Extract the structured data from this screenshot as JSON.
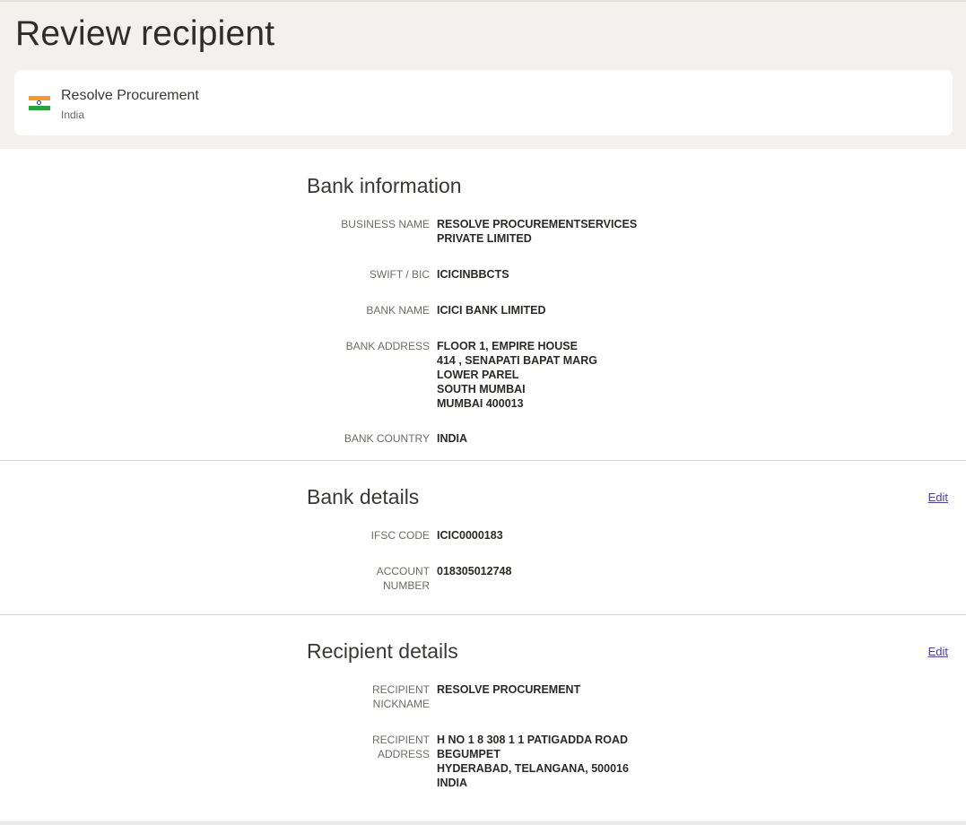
{
  "page": {
    "title": "Review recipient"
  },
  "recipient_card": {
    "flag_icon": "india-flag-icon",
    "name": "Resolve Procurement",
    "country": "India"
  },
  "bank_information": {
    "heading": "Bank information",
    "rows": [
      {
        "label": "BUSINESS NAME",
        "value": "RESOLVE PROCUREMENTSERVICES\nPRIVATE LIMITED"
      },
      {
        "label": "SWIFT / BIC",
        "value": "ICICINBBCTS"
      },
      {
        "label": "BANK NAME",
        "value": "ICICI BANK LIMITED"
      },
      {
        "label": "BANK ADDRESS",
        "value": "FLOOR 1, EMPIRE HOUSE\n414 , SENAPATI BAPAT MARG\nLOWER PAREL\nSOUTH MUMBAI\nMUMBAI 400013"
      },
      {
        "label": "BANK COUNTRY",
        "value": "INDIA"
      }
    ]
  },
  "bank_details": {
    "heading": "Bank details",
    "edit_label": "Edit",
    "rows": [
      {
        "label": "IFSC CODE",
        "value": "ICIC0000183"
      },
      {
        "label": "ACCOUNT\nNUMBER",
        "value": "018305012748"
      }
    ]
  },
  "recipient_details": {
    "heading": "Recipient details",
    "edit_label": "Edit",
    "rows": [
      {
        "label": "RECIPIENT\nNICKNAME",
        "value": "RESOLVE PROCUREMENT"
      },
      {
        "label": "RECIPIENT\nADDRESS",
        "value": "H NO 1 8 308 1 1 PATIGADDA ROAD\nBEGUMPET\nHYDERABAD, TELANGANA, 500016\nINDIA"
      }
    ]
  },
  "colors": {
    "header_background": "#f3f0ed",
    "link": "#4a3f9a",
    "divider": "#d8d5d2"
  }
}
